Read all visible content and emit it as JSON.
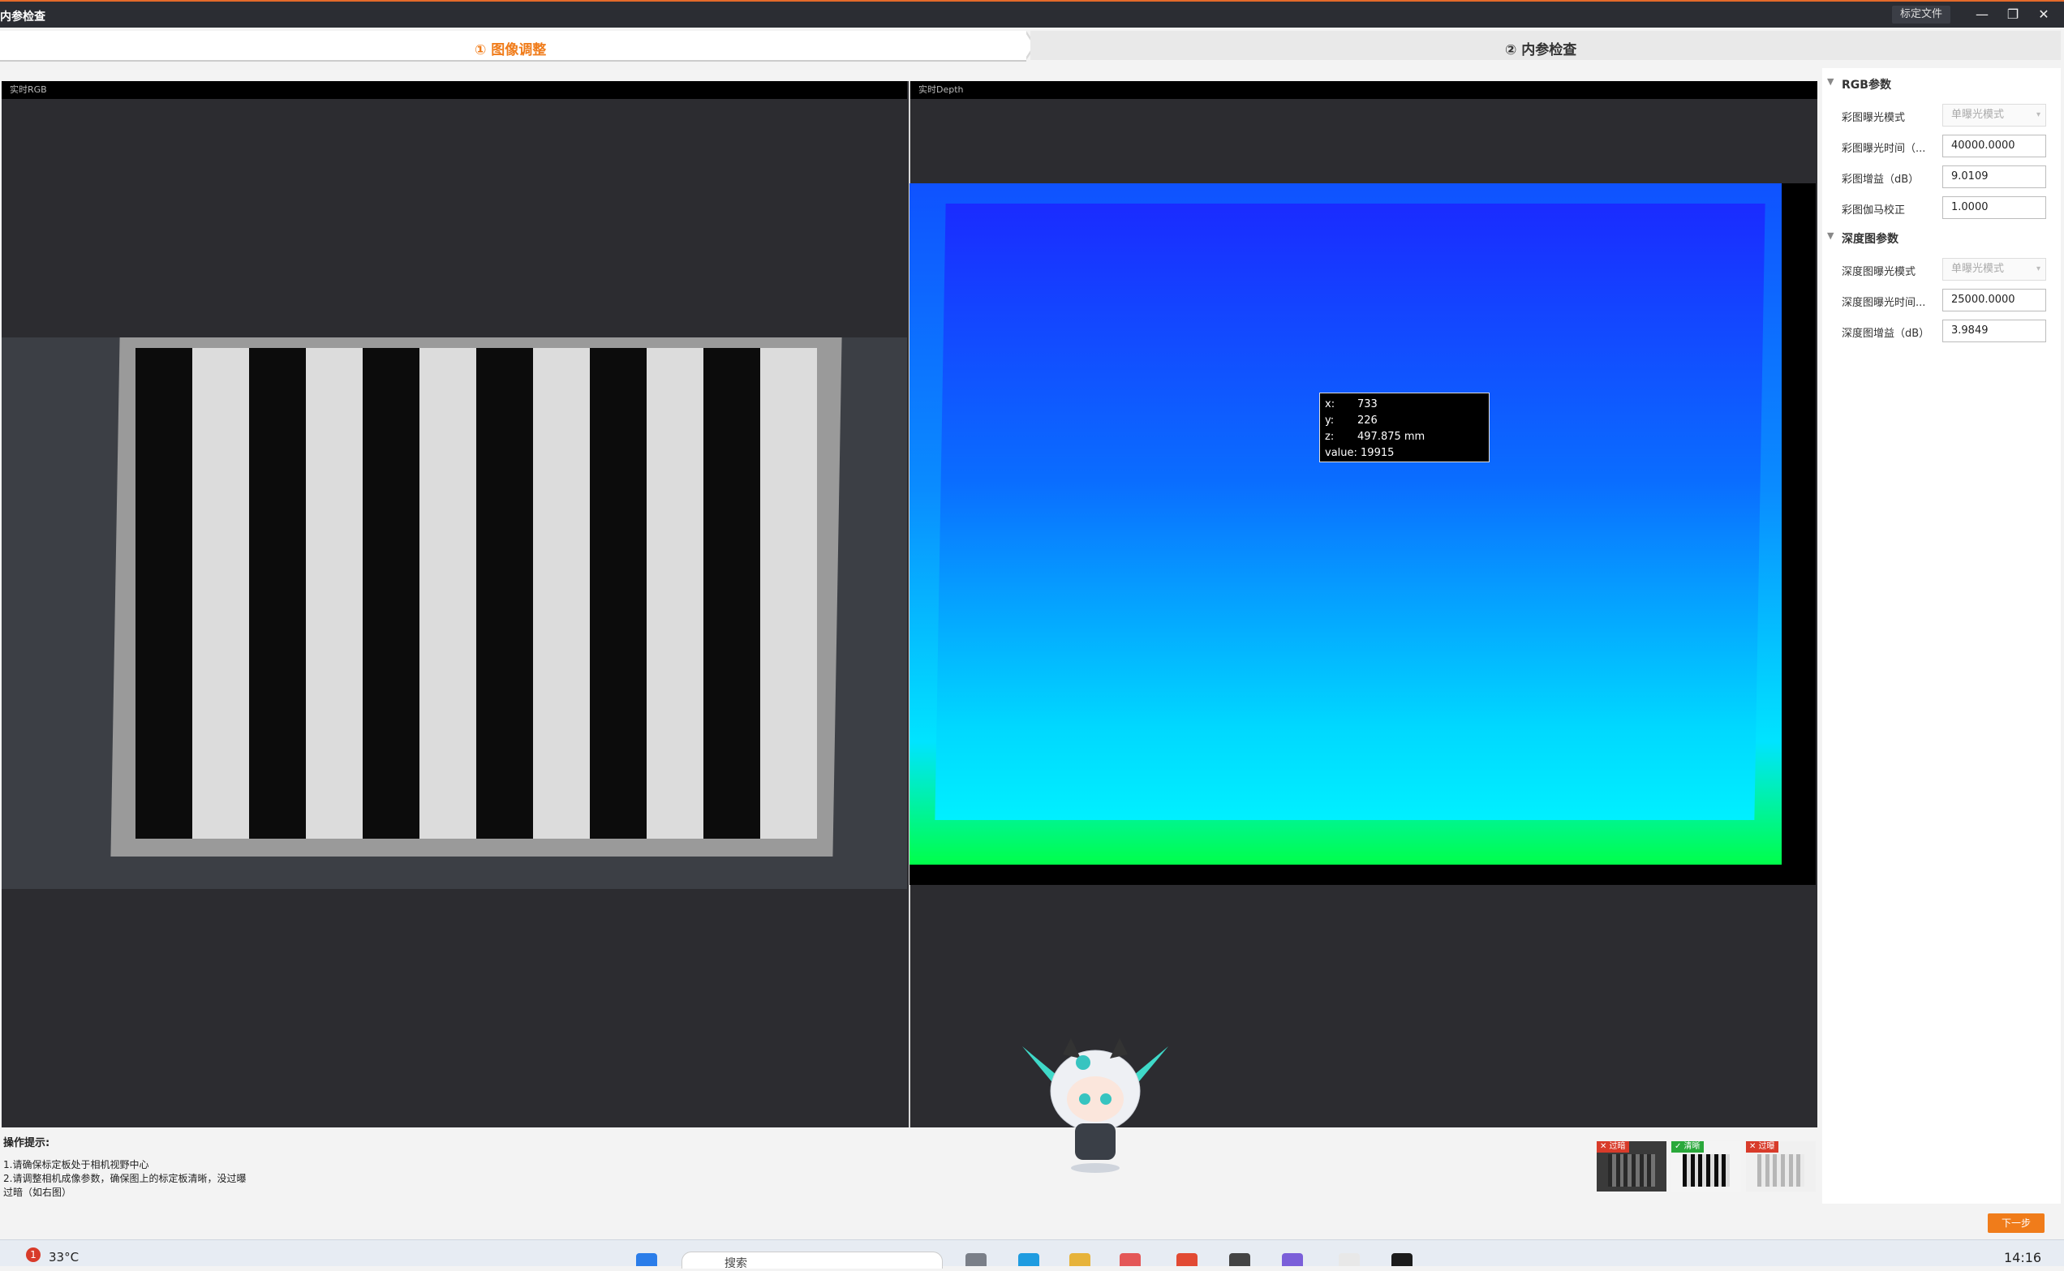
{
  "window": {
    "title": "内参检查",
    "calib_file_button": "标定文件",
    "minimize_glyph": "—",
    "restore_glyph": "❐",
    "close_glyph": "✕"
  },
  "stepper": {
    "step1": "① 图像调整",
    "step2": "② 内参检查"
  },
  "panels": {
    "rgb_title": "实时RGB",
    "depth_title": "实时Depth"
  },
  "tooltip": {
    "x_key": "x:",
    "x": "733",
    "y_key": "y:",
    "y": "226",
    "z_key": "z:",
    "z": "497.875 mm",
    "value_key": "value:",
    "value": "19915"
  },
  "hints": {
    "title": "操作提示:",
    "line1": "1.请确保标定板处于相机视野中心",
    "line2": "2.请调整相机成像参数，确保图上的标定板清晰，没过曝过暗（如右图）"
  },
  "examples": [
    {
      "tag": "✕ 过暗",
      "tag_color": "#d83b2a",
      "bg": "#3a3a3a"
    },
    {
      "tag": "✓ 清晰",
      "tag_color": "#2aa83b",
      "bg": "#f4f4f4"
    },
    {
      "tag": "✕ 过曝",
      "tag_color": "#d83b2a",
      "bg": "#f0f0f0"
    }
  ],
  "side": {
    "rgb_section": "RGB参数",
    "rgb_rows": [
      {
        "label": "彩图曝光模式",
        "value": "单曝光模式",
        "kind": "select"
      },
      {
        "label": "彩图曝光时间（...",
        "value": "40000.0000",
        "kind": "input"
      },
      {
        "label": "彩图增益（dB）",
        "value": "9.0109",
        "kind": "input"
      },
      {
        "label": "彩图伽马校正",
        "value": "1.0000",
        "kind": "input"
      }
    ],
    "depth_section": "深度图参数",
    "depth_rows": [
      {
        "label": "深度图曝光模式",
        "value": "单曝光模式",
        "kind": "select"
      },
      {
        "label": "深度图曝光时间...",
        "value": "25000.0000",
        "kind": "input"
      },
      {
        "label": "深度图增益（dB）",
        "value": "3.9849",
        "kind": "input"
      }
    ]
  },
  "next_button": "下一步",
  "taskbar": {
    "badge": "1",
    "weather": "33°C",
    "search_placeholder": "搜索",
    "clock": "14:16"
  },
  "accent_color": "#f07c1a"
}
